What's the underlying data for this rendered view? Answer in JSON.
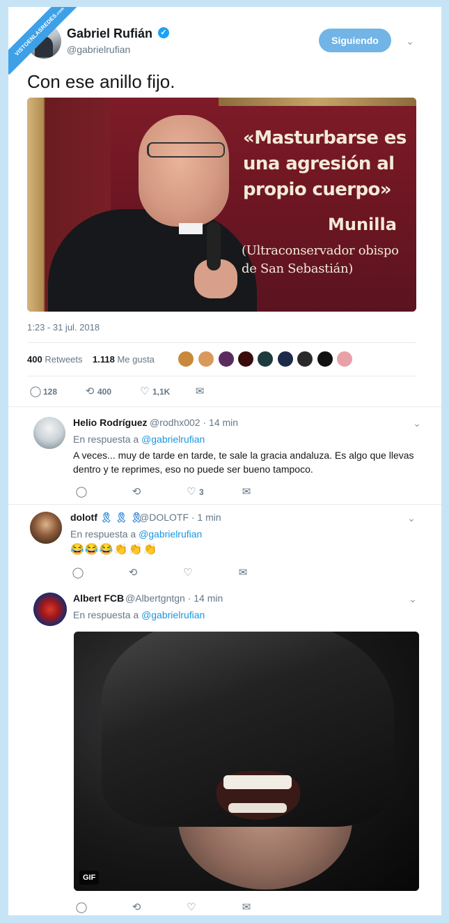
{
  "watermark": {
    "line1": "VISTOENLASREDES",
    "line2": ".com"
  },
  "main_tweet": {
    "author_name": "Gabriel Rufián",
    "author_handle": "@gabrielrufian",
    "follow_label": "Siguiendo",
    "text": "Con ese anillo fijo.",
    "image": {
      "quote_line1": "«Masturbarse es",
      "quote_line2": "una agresión al",
      "quote_line3": "propio cuerpo»",
      "name": "Munilla",
      "caption_line1": "(Ultraconservador obispo",
      "caption_line2": "de San Sebastián)"
    },
    "timestamp": "1:23 - 31 jul. 2018",
    "retweets_count": "400",
    "retweets_label": "Retweets",
    "likes_count": "1.118",
    "likes_label": "Me gusta",
    "actions": {
      "replies": "128",
      "retweets": "400",
      "likes": "1,1K"
    }
  },
  "replies": [
    {
      "name": "Helio Rodríguez",
      "handle": "@rodhx002 · 14 min",
      "reply_prefix": "En respuesta a",
      "reply_to": "@gabrielrufian",
      "text": "A veces... muy de tarde en tarde, te sale la gracia andaluza. Es algo que llevas dentro y te reprimes, eso no puede ser bueno tampoco.",
      "likes": "3"
    },
    {
      "name": "dolotf",
      "name_suffix": "🎗 🎗 🎗",
      "handle": "@DOLOTF · 1 min",
      "reply_prefix": "En respuesta a",
      "reply_to": "@gabrielrufian",
      "text": "😂😂😂👏👏👏"
    },
    {
      "name": "Albert FCB",
      "handle": "@Albertgntgn · 14 min",
      "reply_prefix": "En respuesta a",
      "reply_to": "@gabrielrufian",
      "gif_label": "GIF"
    }
  ],
  "icons": {
    "reply": "reply-icon",
    "retweet": "retweet-icon",
    "like": "heart-icon",
    "message": "mail-icon",
    "chevron": "chevron-down-icon",
    "verified": "verified-badge-icon"
  },
  "colors": {
    "accent": "#1da1f2",
    "follow_button": "#71b4e5",
    "link": "#1b95e0",
    "background": "#c7e4f6"
  }
}
